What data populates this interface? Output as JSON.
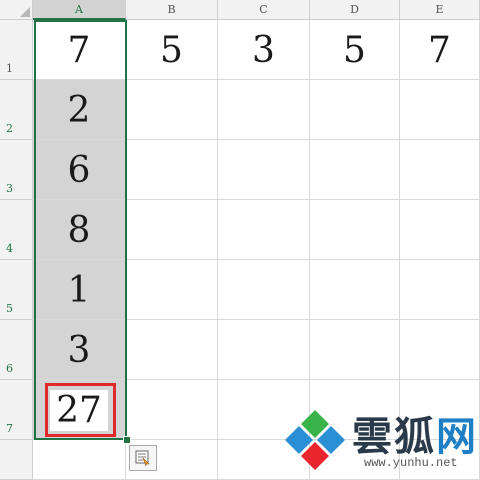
{
  "columns": [
    "A",
    "B",
    "C",
    "D",
    "E"
  ],
  "rows": [
    "1",
    "2",
    "3",
    "4",
    "5",
    "6",
    "7"
  ],
  "cells": {
    "A1": "7",
    "B1": "5",
    "C1": "3",
    "D1": "5",
    "E1": "7",
    "A2": "2",
    "A3": "6",
    "A4": "8",
    "A5": "1",
    "A6": "3",
    "A7": "27"
  },
  "selection": "A2:A7",
  "colors": {
    "accent": "#217346",
    "highlight": "#e0292b",
    "selection_fill": "#d4d4d4"
  },
  "icons": {
    "quick_analysis": "quick-analysis-icon",
    "logo": "yunhu-logo-icon"
  },
  "watermark": {
    "name_part1": "雲",
    "name_part2": "狐",
    "name_part3": "网",
    "url": "www.yunhu.net"
  }
}
